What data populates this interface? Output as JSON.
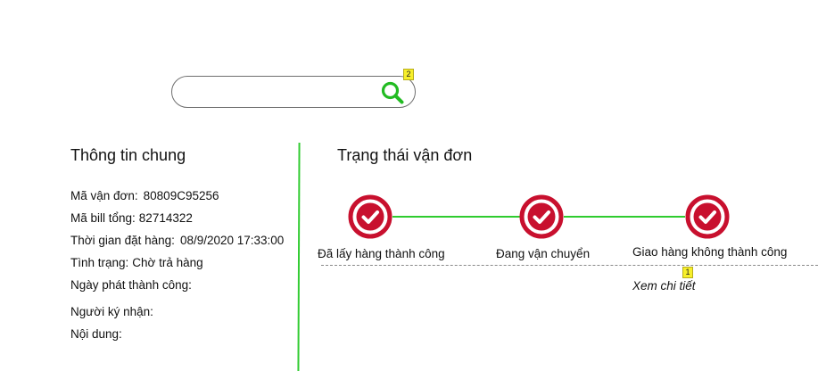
{
  "search": {
    "value": "",
    "placeholder": "",
    "tag": "2"
  },
  "info": {
    "title": "Thông tin chung",
    "rows": [
      {
        "label": "Mã vận đơn:",
        "value": "80809C95256"
      },
      {
        "label": "Mã bill tổng:",
        "value": "82714322"
      },
      {
        "label": "Thời gian đặt hàng:",
        "value": "08/9/2020 17:33:00"
      },
      {
        "label": "Tình trạng:",
        "value": "Chờ trả hàng"
      },
      {
        "label": "Ngày phát thành công:",
        "value": ""
      },
      {
        "label": "Người ký nhận:",
        "value": ""
      },
      {
        "label": "Nội dung:",
        "value": ""
      }
    ]
  },
  "status": {
    "title": "Trạng thái vận đơn",
    "steps": [
      {
        "label": "Đã lấy hàng thành công",
        "icon": "check-circle-icon"
      },
      {
        "label": "Đang vận chuyển",
        "icon": "check-circle-icon"
      },
      {
        "label": "Giao hàng không thành công",
        "icon": "check-circle-icon"
      }
    ],
    "detail_link": "Xem chi tiết",
    "detail_tag": "1"
  },
  "colors": {
    "accent_green": "#2fcc2f",
    "step_red": "#c8102e",
    "tag_yellow": "#f7ef2a"
  }
}
